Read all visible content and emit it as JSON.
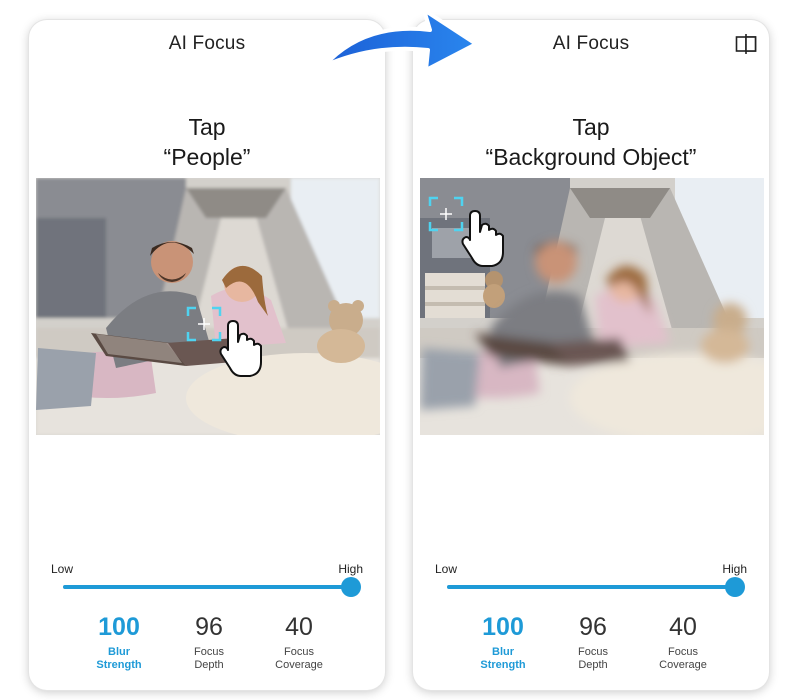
{
  "left_screen": {
    "title": "AI Focus",
    "instruction_line1": "Tap",
    "instruction_line2": "“People”",
    "slider": {
      "low_label": "Low",
      "high_label": "High",
      "value": 1.0
    },
    "metrics": [
      {
        "value": "100",
        "label": "Blur\nStrength",
        "active": true
      },
      {
        "value": "96",
        "label": "Focus\nDepth",
        "active": false
      },
      {
        "value": "40",
        "label": "Focus\nCoverage",
        "active": false
      }
    ],
    "tap_target": "people",
    "photo_blurred": "background"
  },
  "right_screen": {
    "title": "AI Focus",
    "compare_icon": "split-compare-icon",
    "instruction_line1": "Tap",
    "instruction_line2": "“Background Object”",
    "slider": {
      "low_label": "Low",
      "high_label": "High",
      "value": 1.0
    },
    "metrics": [
      {
        "value": "100",
        "label": "Blur\nStrength",
        "active": true
      },
      {
        "value": "96",
        "label": "Focus\nDepth",
        "active": false
      },
      {
        "value": "40",
        "label": "Focus\nCoverage",
        "active": false
      }
    ],
    "tap_target": "background-object",
    "photo_blurred": "people"
  },
  "colors": {
    "accent": "#1e9ad7",
    "arrow": "#1f6fe0"
  }
}
